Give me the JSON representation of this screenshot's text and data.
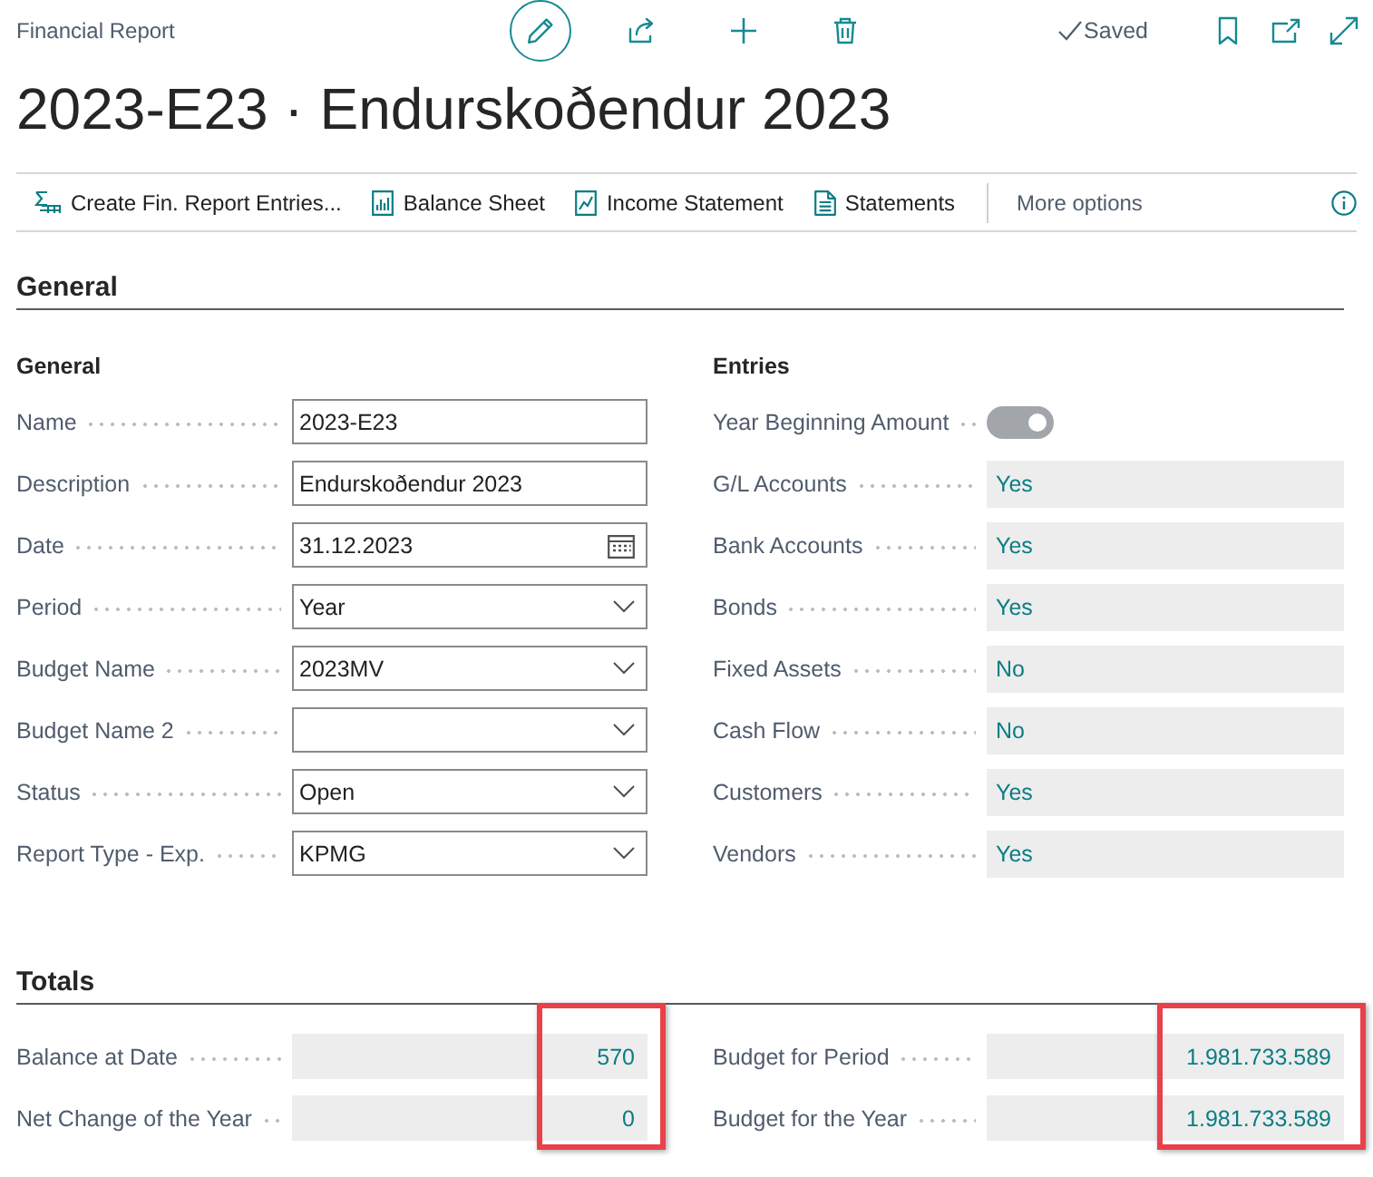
{
  "header": {
    "caption": "Financial Report",
    "edit_mode": true,
    "save_status": "Saved"
  },
  "title": "2023-E23 · Endurskoðendur 2023",
  "actions": [
    {
      "kind": "table",
      "label": "Create Fin. Report Entries..."
    },
    {
      "kind": "barchart",
      "label": "Balance Sheet"
    },
    {
      "kind": "linechart",
      "label": "Income Statement"
    },
    {
      "kind": "document",
      "label": "Statements"
    }
  ],
  "more_options": "More options",
  "general": {
    "heading": "General",
    "left": {
      "heading": "General",
      "fields": [
        {
          "kind": "text",
          "label": "Name",
          "value": "2023-E23"
        },
        {
          "kind": "text",
          "label": "Description",
          "value": "Endurskoðendur 2023"
        },
        {
          "kind": "date",
          "label": "Date",
          "value": "31.12.2023"
        },
        {
          "kind": "dropdown",
          "label": "Period",
          "value": "Year"
        },
        {
          "kind": "dropdown",
          "label": "Budget Name",
          "value": "2023MV"
        },
        {
          "kind": "dropdown",
          "label": "Budget Name 2"
        },
        {
          "kind": "dropdown",
          "label": "Status",
          "value": "Open"
        },
        {
          "kind": "dropdown",
          "label": "Report Type - Exp.",
          "value": "KPMG"
        }
      ]
    },
    "right": {
      "heading": "Entries",
      "toggle": {
        "label": "Year Beginning Amount",
        "on": true,
        "disabled": true
      },
      "fields": [
        {
          "label": "G/L Accounts",
          "value": "Yes"
        },
        {
          "label": "Bank Accounts",
          "value": "Yes"
        },
        {
          "label": "Bonds",
          "value": "Yes"
        },
        {
          "label": "Fixed Assets",
          "value": "No"
        },
        {
          "label": "Cash Flow",
          "value": "No"
        },
        {
          "label": "Customers",
          "value": "Yes"
        },
        {
          "label": "Vendors",
          "value": "Yes"
        }
      ]
    }
  },
  "totals": {
    "heading": "Totals",
    "columns": [
      {
        "highlighted": true,
        "fields": [
          {
            "label": "Balance at Date",
            "value": "570"
          },
          {
            "label": "Net Change of the Year",
            "value": "0"
          }
        ]
      },
      {
        "highlighted": true,
        "fields": [
          {
            "label": "Budget for Period",
            "value": "1.981.733.589"
          },
          {
            "label": "Budget for the Year",
            "value": "1.981.733.589"
          }
        ]
      }
    ]
  }
}
